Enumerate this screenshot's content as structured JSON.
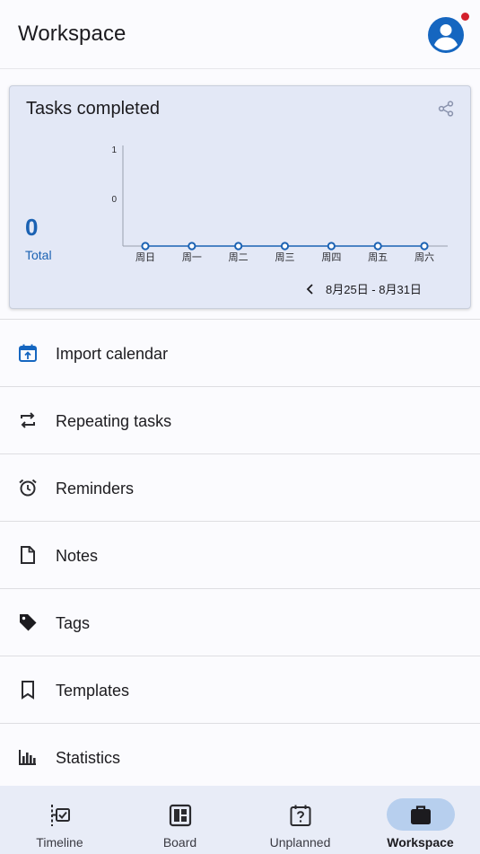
{
  "header": {
    "title": "Workspace",
    "avatar_icon": "account-circle-icon",
    "notification_dot_color": "#d3202c"
  },
  "stats_card": {
    "title": "Tasks completed",
    "share_icon": "share-icon",
    "total_value": "0",
    "total_label": "Total",
    "date_range": "8月25日 - 8月31日",
    "prev_icon": "chevron-left-icon"
  },
  "chart_data": {
    "type": "line",
    "categories": [
      "周日",
      "周一",
      "周二",
      "周三",
      "周四",
      "周五",
      "周六"
    ],
    "series": [
      {
        "values": [
          0,
          0,
          0,
          0,
          0,
          0,
          0
        ]
      }
    ],
    "y_ticks": [
      "1",
      "0"
    ],
    "ylim": [
      0,
      1
    ],
    "grid": false,
    "line_color": "#1b62b3"
  },
  "menu": {
    "items": [
      {
        "label": "Import calendar",
        "icon": "calendar-import-icon"
      },
      {
        "label": "Repeating tasks",
        "icon": "repeat-icon"
      },
      {
        "label": "Reminders",
        "icon": "alarm-icon"
      },
      {
        "label": "Notes",
        "icon": "note-icon"
      },
      {
        "label": "Tags",
        "icon": "tag-icon"
      },
      {
        "label": "Templates",
        "icon": "bookmark-icon"
      },
      {
        "label": "Statistics",
        "icon": "bar-chart-icon"
      }
    ]
  },
  "bottom_nav": {
    "items": [
      {
        "label": "Timeline",
        "icon": "timeline-icon"
      },
      {
        "label": "Board",
        "icon": "board-icon"
      },
      {
        "label": "Unplanned",
        "icon": "unplanned-calendar-icon"
      },
      {
        "label": "Workspace",
        "icon": "briefcase-icon",
        "active": true
      }
    ],
    "active_pill_color": "#b7cfee"
  },
  "colors": {
    "accent": "#1b62b3",
    "card_bg": "#e3e8f6",
    "nav_bg": "#e8ecf7"
  }
}
